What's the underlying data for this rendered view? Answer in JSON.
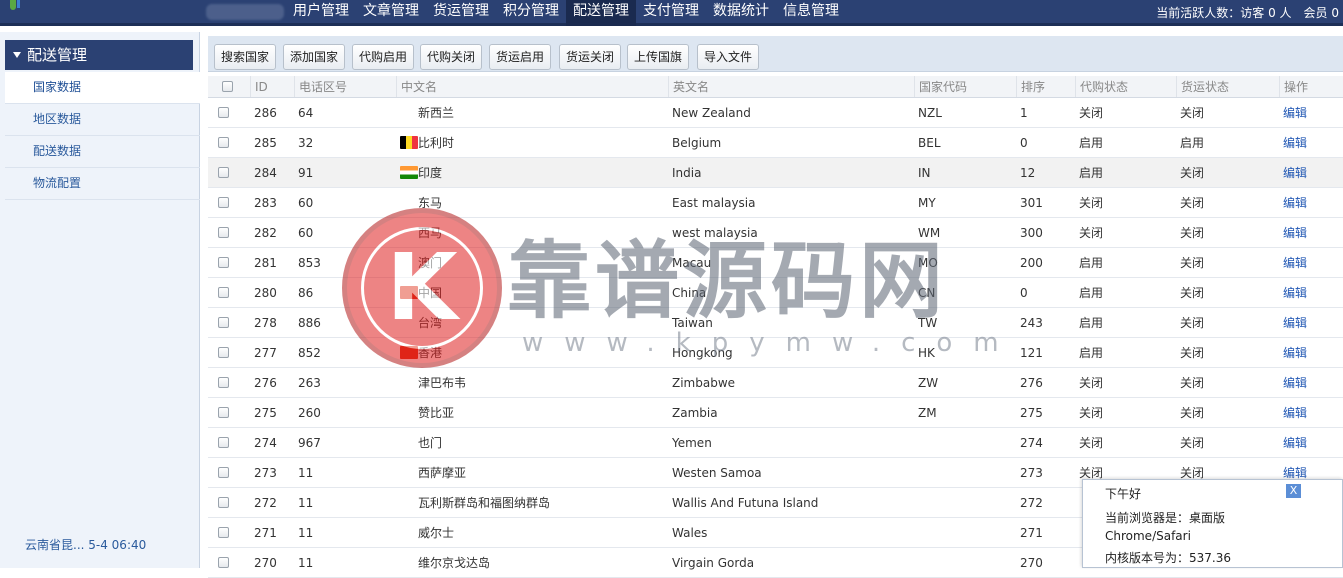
{
  "header": {
    "nav": [
      "用户管理",
      "文章管理",
      "货运管理",
      "积分管理",
      "配送管理",
      "支付管理",
      "数据统计",
      "信息管理"
    ],
    "active_nav": "配送管理",
    "online_text": "当前活跃人数：访客 0 人　会员 0"
  },
  "sidebar": {
    "title": "配送管理",
    "items": [
      {
        "label": "国家数据"
      },
      {
        "label": "地区数据"
      },
      {
        "label": "配送数据"
      },
      {
        "label": "物流配置"
      }
    ],
    "footer": "云南省昆...  5-4 06:40"
  },
  "toolbar": {
    "buttons": [
      "搜索国家",
      "添加国家",
      "代购启用",
      "代购关闭",
      "货运启用",
      "货运关闭",
      "上传国旗",
      "导入文件"
    ]
  },
  "table": {
    "headers": [
      "",
      "ID",
      "电话区号",
      "中文名",
      "英文名",
      "国家代码",
      "排序",
      "代购状态",
      "货运状态",
      "操作"
    ],
    "rows": [
      {
        "id": "286",
        "phone": "64",
        "cn": "新西兰",
        "en": "New Zealand",
        "code": "NZL",
        "sort": "1",
        "daigou": "关闭",
        "huoyun": "关闭",
        "action": "编辑",
        "flag": ""
      },
      {
        "id": "285",
        "phone": "32",
        "cn": "比利时",
        "en": "Belgium",
        "code": "BEL",
        "sort": "0",
        "daigou": "启用",
        "huoyun": "启用",
        "action": "编辑",
        "flag": "be"
      },
      {
        "id": "284",
        "phone": "91",
        "cn": "印度",
        "en": "India",
        "code": "IN",
        "sort": "12",
        "daigou": "启用",
        "huoyun": "关闭",
        "action": "编辑",
        "flag": "in"
      },
      {
        "id": "283",
        "phone": "60",
        "cn": "东马",
        "en": "East malaysia",
        "code": "MY",
        "sort": "301",
        "daigou": "关闭",
        "huoyun": "关闭",
        "action": "编辑",
        "flag": ""
      },
      {
        "id": "282",
        "phone": "60",
        "cn": "西马",
        "en": "west malaysia",
        "code": "WM",
        "sort": "300",
        "daigou": "关闭",
        "huoyun": "关闭",
        "action": "编辑",
        "flag": ""
      },
      {
        "id": "281",
        "phone": "853",
        "cn": "澳门",
        "en": "Macau",
        "code": "MO",
        "sort": "200",
        "daigou": "启用",
        "huoyun": "关闭",
        "action": "编辑",
        "flag": ""
      },
      {
        "id": "280",
        "phone": "86",
        "cn": "中国",
        "en": "China",
        "code": "CN",
        "sort": "0",
        "daigou": "启用",
        "huoyun": "关闭",
        "action": "编辑",
        "flag": "cn"
      },
      {
        "id": "278",
        "phone": "886",
        "cn": "台湾",
        "en": "Taiwan",
        "code": "TW",
        "sort": "243",
        "daigou": "启用",
        "huoyun": "关闭",
        "action": "编辑",
        "flag": ""
      },
      {
        "id": "277",
        "phone": "852",
        "cn": "香港",
        "en": "Hongkong",
        "code": "HK",
        "sort": "121",
        "daigou": "启用",
        "huoyun": "关闭",
        "action": "编辑",
        "flag": "hk"
      },
      {
        "id": "276",
        "phone": "263",
        "cn": "津巴布韦",
        "en": "Zimbabwe",
        "code": "ZW",
        "sort": "276",
        "daigou": "关闭",
        "huoyun": "关闭",
        "action": "编辑",
        "flag": ""
      },
      {
        "id": "275",
        "phone": "260",
        "cn": "赞比亚",
        "en": "Zambia",
        "code": "ZM",
        "sort": "275",
        "daigou": "关闭",
        "huoyun": "关闭",
        "action": "编辑",
        "flag": ""
      },
      {
        "id": "274",
        "phone": "967",
        "cn": "也门",
        "en": "Yemen",
        "code": "",
        "sort": "274",
        "daigou": "关闭",
        "huoyun": "关闭",
        "action": "编辑",
        "flag": ""
      },
      {
        "id": "273",
        "phone": "11",
        "cn": "西萨摩亚",
        "en": "Westen Samoa",
        "code": "",
        "sort": "273",
        "daigou": "关闭",
        "huoyun": "关闭",
        "action": "编辑",
        "flag": ""
      },
      {
        "id": "272",
        "phone": "11",
        "cn": "瓦利斯群岛和福图纳群岛",
        "en": "Wallis And Futuna Island",
        "code": "",
        "sort": "272",
        "daigou": "",
        "huoyun": "",
        "action": "",
        "flag": ""
      },
      {
        "id": "271",
        "phone": "11",
        "cn": "威尔士",
        "en": "Wales",
        "code": "",
        "sort": "271",
        "daigou": "",
        "huoyun": "",
        "action": "",
        "flag": ""
      },
      {
        "id": "270",
        "phone": "11",
        "cn": "维尔京戈达岛",
        "en": "Virgain Gorda",
        "code": "",
        "sort": "270",
        "daigou": "",
        "huoyun": "",
        "action": "",
        "flag": ""
      }
    ]
  },
  "watermark": {
    "logo_letter": "K",
    "text": "靠谱源码网",
    "url": "www.kpymw.com"
  },
  "popup": {
    "title": "下午好",
    "close_label": "X",
    "lines": [
      "当前浏览器是：桌面版",
      "Chrome/Safari",
      "内核版本号为：537.36"
    ]
  }
}
